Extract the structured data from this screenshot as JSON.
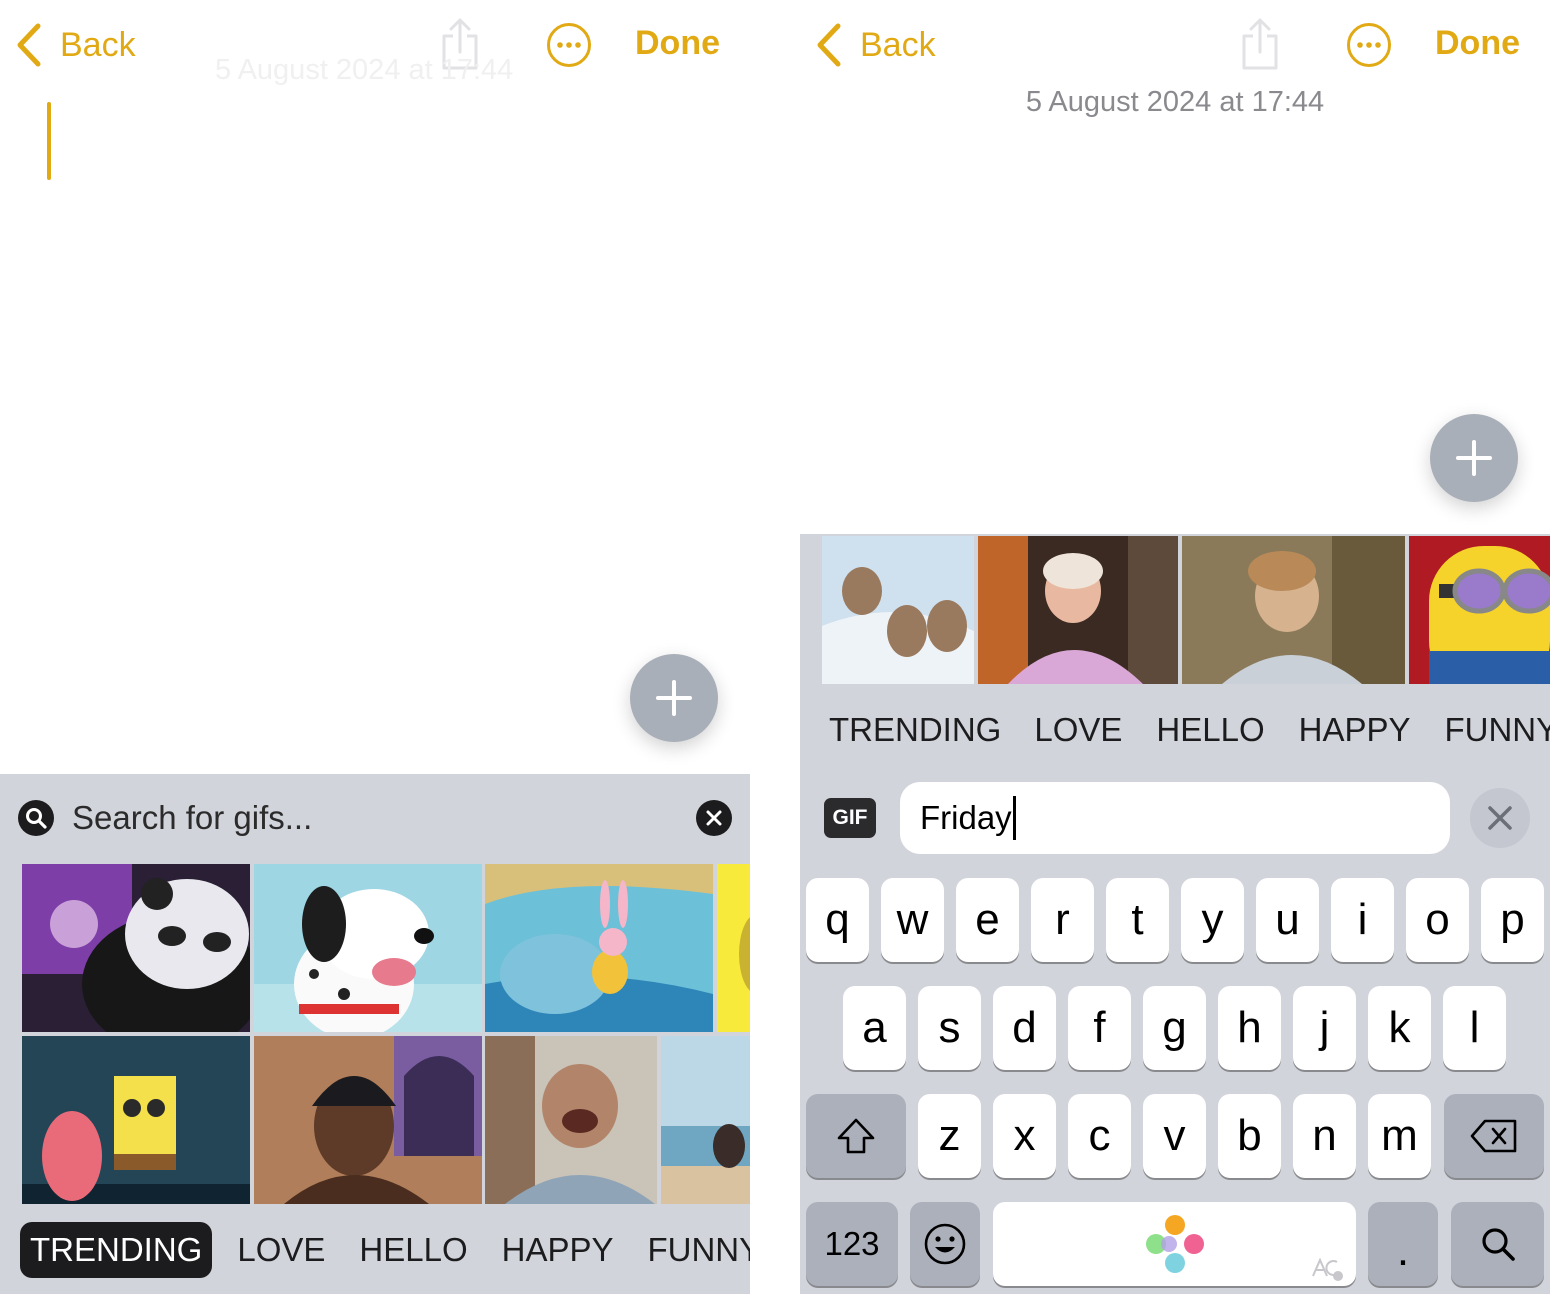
{
  "accent_color": "#E1A914",
  "left": {
    "nav": {
      "back_label": "Back",
      "done_label": "Done"
    },
    "date_ghost": "5 August 2024 at 17:44",
    "gif_keyboard": {
      "search_placeholder": "Search for gifs...",
      "categories": [
        "TRENDING",
        "LOVE",
        "HELLO",
        "HAPPY",
        "FUNNY"
      ],
      "active_category": "TRENDING"
    }
  },
  "right": {
    "nav": {
      "back_label": "Back",
      "done_label": "Done"
    },
    "date": "5 August 2024 at 17:44",
    "gif_keyboard": {
      "categories": [
        "TRENDING",
        "LOVE",
        "HELLO",
        "HAPPY",
        "FUNNY"
      ],
      "gif_badge": "GIF",
      "search_value": "Friday"
    },
    "keyboard": {
      "row1": [
        "q",
        "w",
        "e",
        "r",
        "t",
        "y",
        "u",
        "i",
        "o",
        "p"
      ],
      "row2": [
        "a",
        "s",
        "d",
        "f",
        "g",
        "h",
        "j",
        "k",
        "l"
      ],
      "row3": [
        "z",
        "x",
        "c",
        "v",
        "b",
        "n",
        "m"
      ],
      "numbers_label": "123",
      "period_label": "."
    }
  }
}
